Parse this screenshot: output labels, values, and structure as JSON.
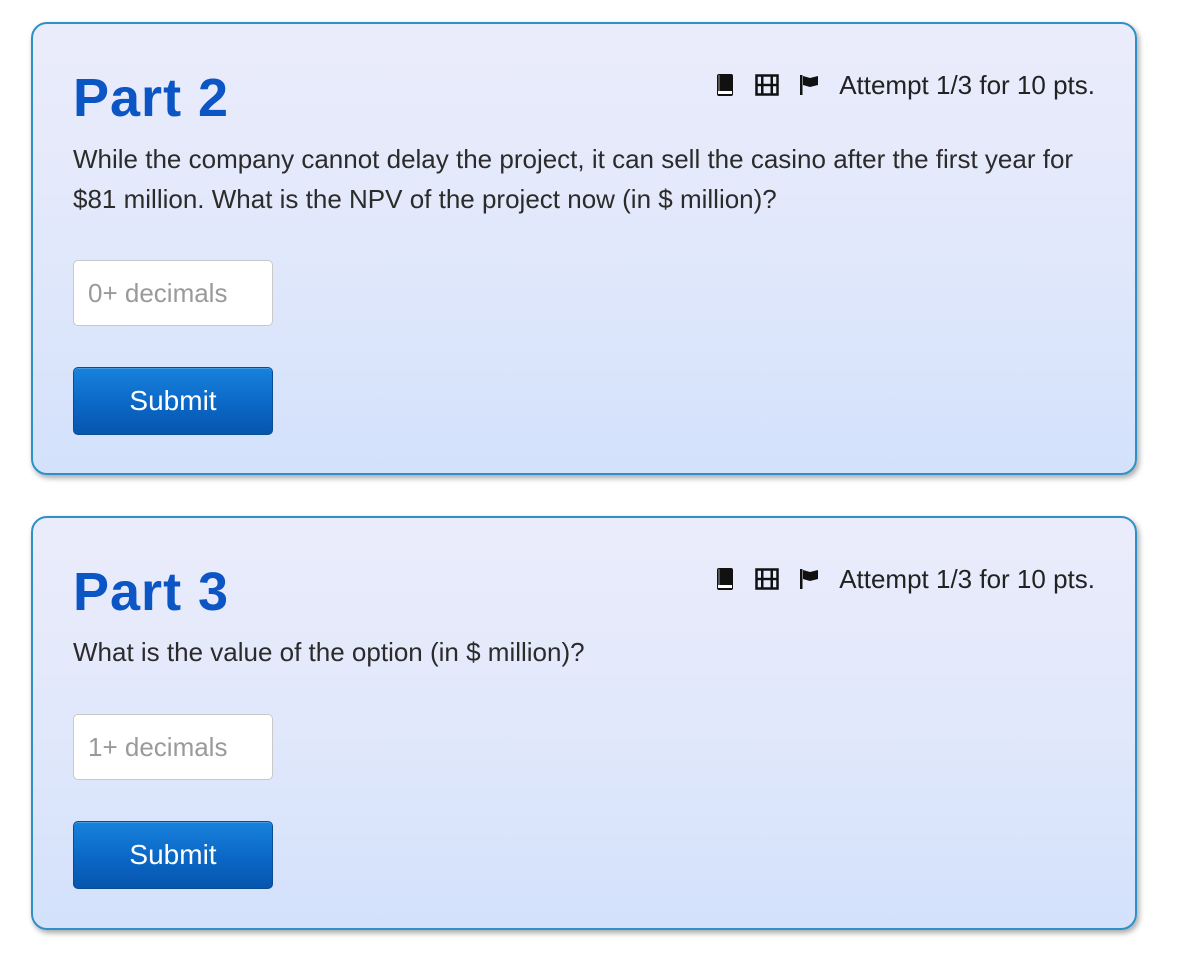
{
  "parts": [
    {
      "title": "Part 2",
      "attempt": "Attempt 1/3 for 10 pts.",
      "question": "While the company cannot delay the project, it can sell the casino after the first year for $81 million. What is the NPV of the project now (in $ million)?",
      "input_placeholder": "0+ decimals",
      "submit_label": "Submit",
      "icons": [
        "book-icon",
        "film-icon",
        "flag-icon"
      ]
    },
    {
      "title": "Part 3",
      "attempt": "Attempt 1/3 for 10 pts.",
      "question": "What is the value of the option (in $ million)?",
      "input_placeholder": "1+ decimals",
      "submit_label": "Submit",
      "icons": [
        "book-icon",
        "film-icon",
        "flag-icon"
      ]
    }
  ],
  "colors": {
    "title": "#0b56c4",
    "card_border": "#2f90c8",
    "button": "#0b67c6"
  }
}
